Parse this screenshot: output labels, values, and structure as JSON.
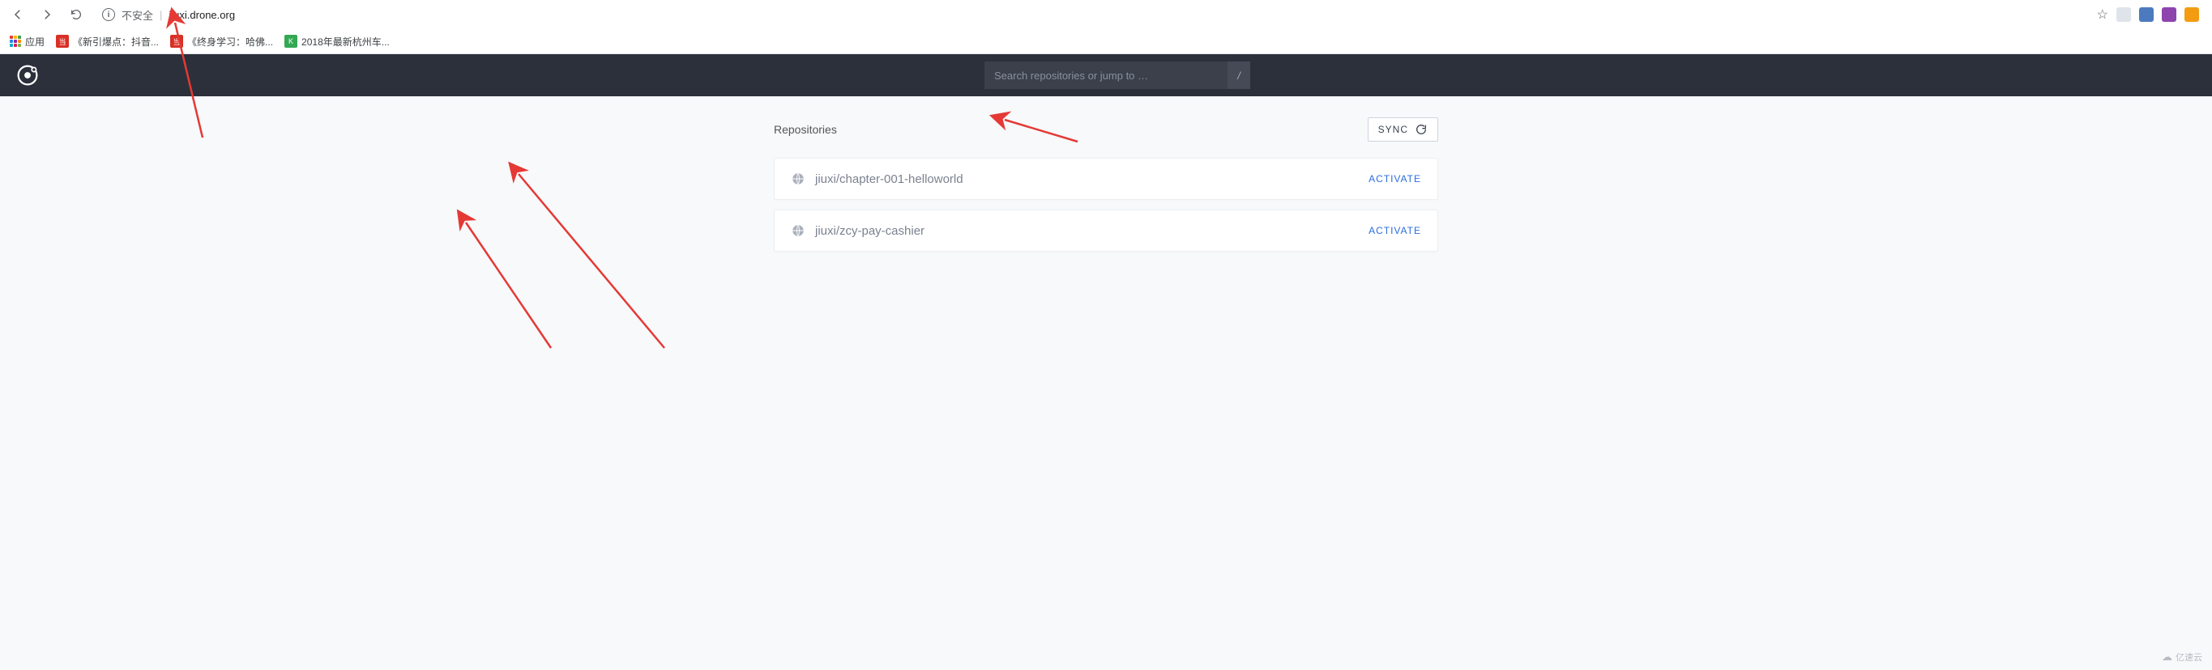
{
  "browser": {
    "security_label": "不安全",
    "url": "jiuxi.drone.org",
    "apps_label": "应用",
    "bookmarks": [
      {
        "label": "《新引爆点：抖音...",
        "color": "#d93025"
      },
      {
        "label": "《终身学习：哈佛...",
        "color": "#d93025"
      },
      {
        "label": "2018年最新杭州车...",
        "color": "#34a853"
      }
    ]
  },
  "header": {
    "search_placeholder": "Search repositories or jump to …",
    "slash_hint": "/"
  },
  "main": {
    "section_title": "Repositories",
    "sync_label": "SYNC",
    "repos": [
      {
        "name": "jiuxi/chapter-001-helloworld",
        "action": "ACTIVATE"
      },
      {
        "name": "jiuxi/zcy-pay-cashier",
        "action": "ACTIVATE"
      }
    ]
  },
  "watermark": "亿速云"
}
